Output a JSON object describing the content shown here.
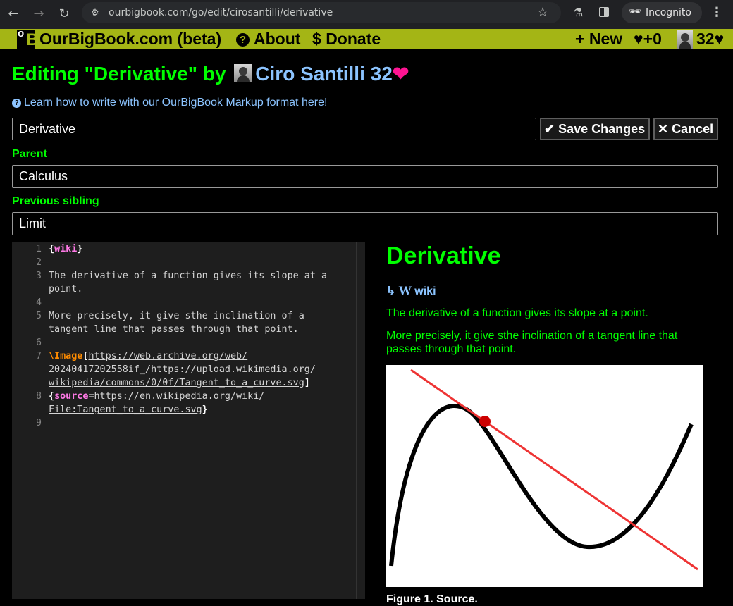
{
  "browser": {
    "url": "ourbigbook.com/go/edit/cirosantilli/derivative",
    "incognito_label": "Incognito"
  },
  "nav": {
    "brand": "OurBigBook.com (beta)",
    "about": "About",
    "donate_symbol": "$",
    "donate": "Donate",
    "new": "New",
    "likes": "+0",
    "user_score": "32"
  },
  "header": {
    "prefix": "Editing \"Derivative\" by",
    "author": "Ciro Santilli",
    "score": "32",
    "heart": "❤",
    "help_text": "Learn how to write with our OurBigBook Markup format here!"
  },
  "form": {
    "title_value": "Derivative",
    "save_label": "Save Changes",
    "cancel_label": "Cancel",
    "parent_label": "Parent",
    "parent_value": "Calculus",
    "prev_sibling_label": "Previous sibling",
    "prev_sibling_value": "Limit"
  },
  "editor": {
    "line_numbers": [
      "1",
      "2",
      "3",
      "4",
      "5",
      "6",
      "7",
      "8",
      "9"
    ],
    "line1_kw": "wiki",
    "line3a": "The derivative of a function gives its slope at a",
    "line3b": "point.",
    "line5a": "More precisely, it give sthe inclination of a",
    "line5b": "tangent line that passes through that point.",
    "line7_macro": "\\Image",
    "line7_url_a": "https://web.archive.org/web/",
    "line7_url_b": "20240417202558if_/https://upload.wikimedia.org/",
    "line7_url_c": "wikipedia/commons/0/0f/Tangent_to_a_curve.svg",
    "line8_kw": "source",
    "line8_url_a": "https://en.wikipedia.org/wiki/",
    "line8_url_b": "File:Tangent_to_a_curve.svg"
  },
  "preview": {
    "title": "Derivative",
    "wiki_arrow": "↳",
    "wiki_w": "W",
    "wiki_label": "wiki",
    "para1": "The derivative of a function gives its slope at a point.",
    "para2": "More precisely, it give sthe inclination of a tangent line that passes through that point.",
    "caption": "Figure 1. Source."
  },
  "colors": {
    "nav_bg": "#a4b515",
    "green_text": "#00ff00",
    "link_blue": "#8cc4ff",
    "heart_pink": "#ff1493",
    "tangent_red": "#ee3333"
  },
  "icons": [
    "back-arrow-icon",
    "forward-arrow-icon",
    "reload-icon",
    "site-settings-icon",
    "star-icon",
    "flask-icon",
    "side-panel-icon",
    "incognito-icon",
    "kebab-menu-icon",
    "logo-icon",
    "question-circle-icon",
    "plus-icon",
    "heart-icon",
    "check-icon",
    "x-icon",
    "wikipedia-w-icon"
  ]
}
